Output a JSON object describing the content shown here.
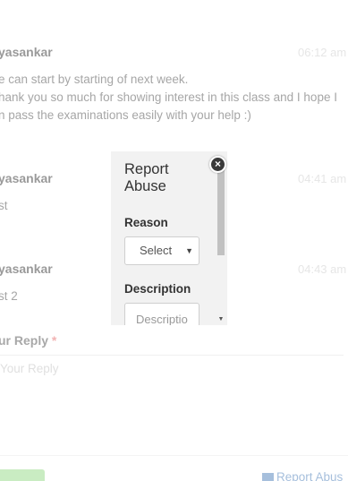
{
  "messages": [
    {
      "name": "yasankar",
      "time": "06:12 am",
      "lines": [
        "e can start by starting of next week.",
        "hank you so much for showing interest in this class and I hope I",
        "n pass the examinations easily with your help :)"
      ]
    },
    {
      "name": "yasankar",
      "time": "04:41 am",
      "lines": [
        "st"
      ]
    },
    {
      "name": "yasankar",
      "time": "04:43 am",
      "lines": [
        "st 2"
      ]
    }
  ],
  "reply": {
    "label": "ur Reply",
    "required_mark": "*",
    "placeholder": "Your Reply"
  },
  "footer": {
    "report_link": "Report Abus"
  },
  "modal": {
    "title": "Report Abuse",
    "reason_label": "Reason",
    "reason_value": "Select",
    "description_label": "Description",
    "description_placeholder": "Description"
  },
  "close_icon": "×"
}
